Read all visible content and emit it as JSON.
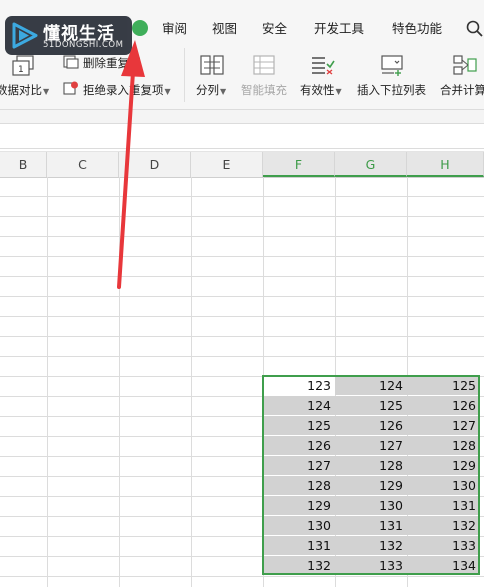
{
  "menu": {
    "tabs": [
      "审阅",
      "视图",
      "安全",
      "开发工具",
      "特色功能"
    ]
  },
  "ribbon": {
    "compare_label": "数据对比",
    "delete_dup_label": "删除重复项",
    "reject_dup_label": "拒绝录入重复项",
    "split_label": "分列",
    "smart_fill_label": "智能填充",
    "validity_label": "有效性",
    "insert_dropdown_label": "插入下拉列表",
    "merge_calc_label": "合并计算"
  },
  "sheet": {
    "columns": [
      "B",
      "C",
      "D",
      "E",
      "F",
      "G",
      "H"
    ],
    "selected_columns": [
      "F",
      "G",
      "H"
    ],
    "rows": [
      [
        "123",
        "124",
        "125"
      ],
      [
        "124",
        "125",
        "126"
      ],
      [
        "125",
        "126",
        "127"
      ],
      [
        "126",
        "127",
        "128"
      ],
      [
        "127",
        "128",
        "129"
      ],
      [
        "128",
        "129",
        "130"
      ],
      [
        "129",
        "130",
        "131"
      ],
      [
        "130",
        "131",
        "132"
      ],
      [
        "131",
        "132",
        "133"
      ],
      [
        "132",
        "133",
        "134"
      ]
    ]
  },
  "logo": {
    "title": "懂视生活",
    "subtitle": "51DONGSHI.COM"
  },
  "colors": {
    "selection_green": "#3f9e4c",
    "arrow_red": "#e8373b",
    "logo_bg": "#30353e",
    "selected_cell_bg": "#d2d2d2"
  }
}
